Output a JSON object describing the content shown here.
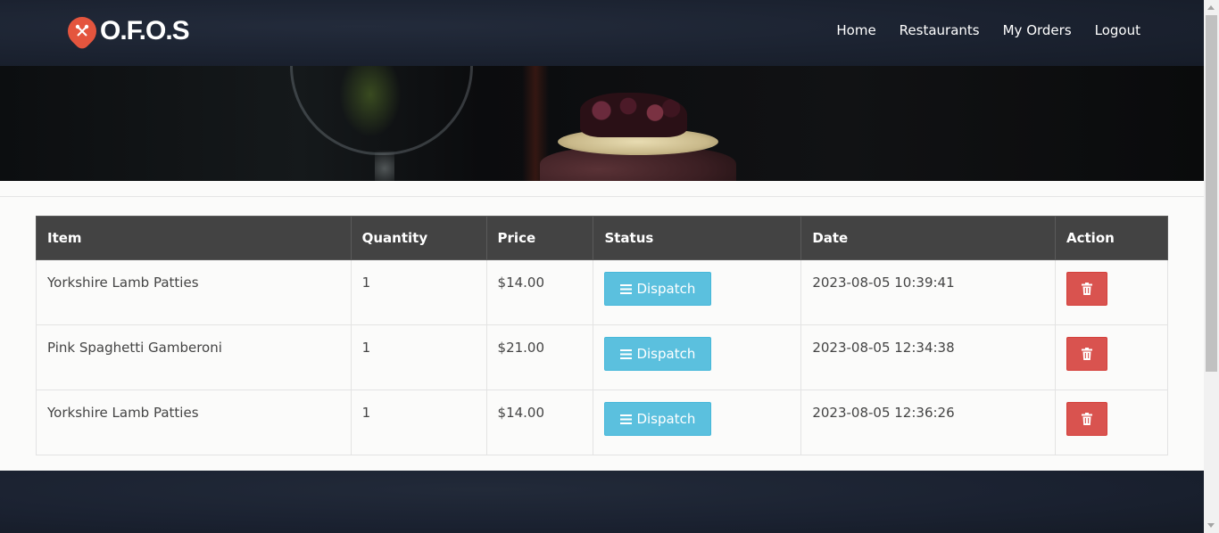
{
  "brand": {
    "name": "O.F.O.S",
    "logo_icon": "fork-knife-pin-icon",
    "accent": "#e4553e"
  },
  "nav": {
    "items": [
      {
        "label": "Home"
      },
      {
        "label": "Restaurants"
      },
      {
        "label": "My Orders"
      },
      {
        "label": "Logout"
      }
    ]
  },
  "orders": {
    "columns": [
      "Item",
      "Quantity",
      "Price",
      "Status",
      "Date",
      "Action"
    ],
    "rows": [
      {
        "item": "Yorkshire Lamb Patties",
        "quantity": "1",
        "price": "$14.00",
        "status": "Dispatch",
        "date": "2023-08-05 10:39:41"
      },
      {
        "item": "Pink Spaghetti Gamberoni",
        "quantity": "1",
        "price": "$21.00",
        "status": "Dispatch",
        "date": "2023-08-05 12:34:38"
      },
      {
        "item": "Yorkshire Lamb Patties",
        "quantity": "1",
        "price": "$14.00",
        "status": "Dispatch",
        "date": "2023-08-05 12:36:26"
      }
    ],
    "status_color": "#5bc0de",
    "delete_color": "#d9534f",
    "status_icon": "menu-bars-icon",
    "delete_icon": "trash-icon"
  }
}
